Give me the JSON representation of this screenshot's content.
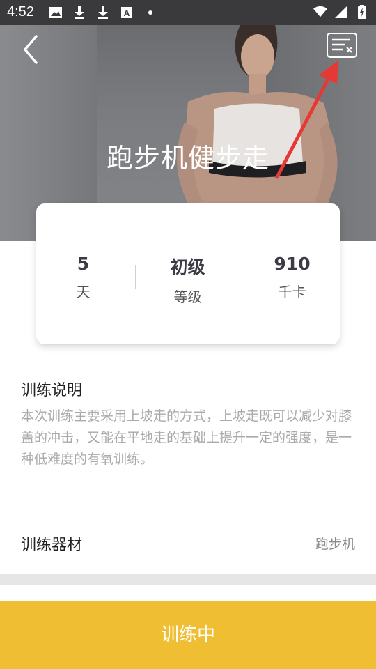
{
  "status_bar": {
    "time": "4:52",
    "left_icons": [
      "image-icon",
      "download-icon",
      "download-icon",
      "font-a-icon",
      "dot-icon"
    ],
    "right_icons": [
      "wifi-icon",
      "signal-icon",
      "battery-charging-icon"
    ]
  },
  "hero": {
    "title": "跑步机健步走",
    "back_icon": "chevron-left-icon",
    "menu_icon": "list-close-icon"
  },
  "stats": [
    {
      "value": "5",
      "unit": "天"
    },
    {
      "value": "初级",
      "unit": "等级"
    },
    {
      "value": "910",
      "unit": "千卡"
    }
  ],
  "description": {
    "title": "训练说明",
    "text": "本次训练主要采用上坡走的方式，上坡走既可以减少对膝盖的冲击，又能在平地走的基础上提升一定的强度，是一种低难度的有氧训练。"
  },
  "equipment": {
    "label": "训练器材",
    "value": "跑步机"
  },
  "action": {
    "label": "训练中"
  },
  "colors": {
    "accent": "#efbe33",
    "annotation_arrow": "#e53935"
  }
}
